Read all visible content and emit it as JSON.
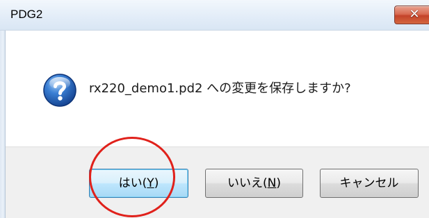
{
  "window": {
    "title": "PDG2",
    "close_icon": "close-icon"
  },
  "message": {
    "icon": "question-icon",
    "text": "rx220_demo1.pd2 への変更を保存しますか?"
  },
  "buttons": {
    "yes": {
      "label_prefix": "はい(",
      "mnemonic": "Y",
      "label_suffix": ")"
    },
    "no": {
      "label_prefix": "いいえ(",
      "mnemonic": "N",
      "label_suffix": ")"
    },
    "cancel": {
      "label": "キャンセル"
    }
  },
  "annotation": {
    "type": "red-circle",
    "color": "#e0211b",
    "target": "yes-button"
  },
  "colors": {
    "title_bar": "#e3edf8",
    "close_button": "#c4432a",
    "button_area": "#f0f0f0",
    "default_button_border": "#3c7fb1"
  }
}
